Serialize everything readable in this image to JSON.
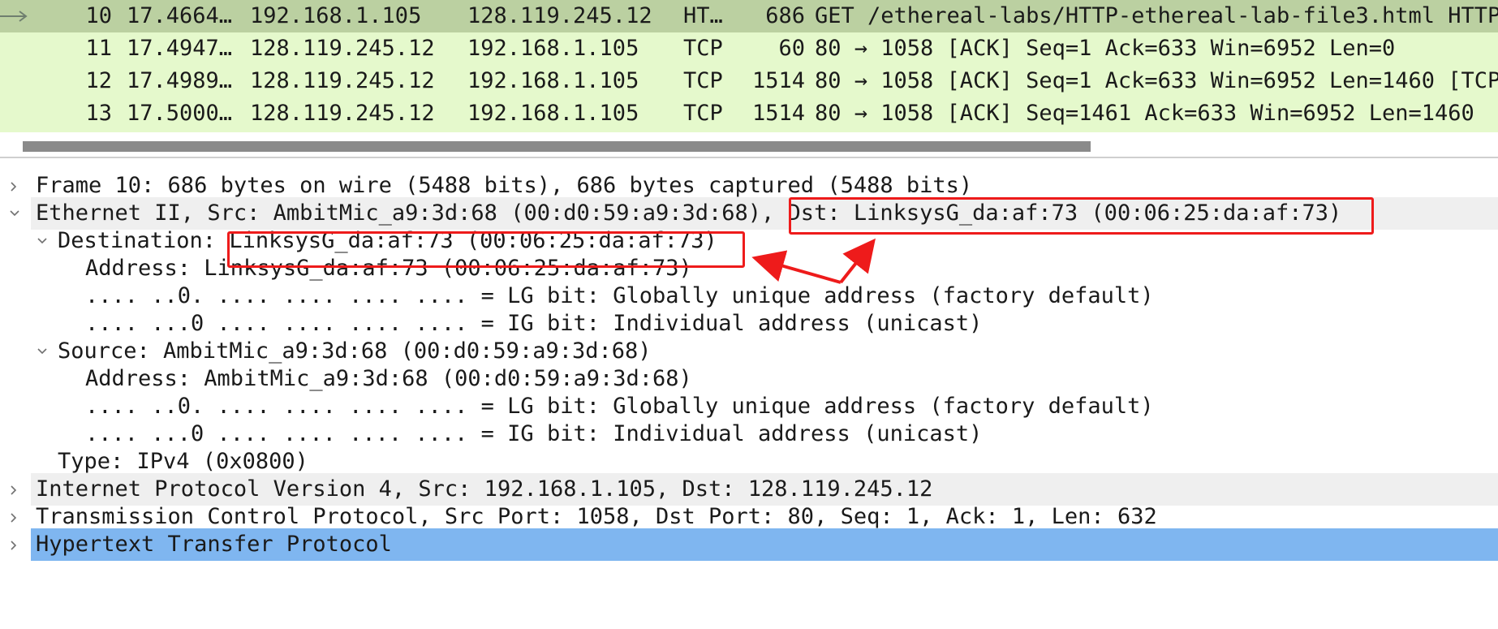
{
  "packet_list": {
    "rows": [
      {
        "no": "10",
        "time": "17.4664…",
        "src": "192.168.1.105",
        "dst": "128.119.245.12",
        "proto": "HT…",
        "len": "686",
        "info": "GET /ethereal-labs/HTTP-ethereal-lab-file3.html HTTP/1.1",
        "selected": true
      },
      {
        "no": "11",
        "time": "17.4947…",
        "src": "128.119.245.12",
        "dst": "192.168.1.105",
        "proto": "TCP",
        "len": "60",
        "info": "80 → 1058 [ACK] Seq=1 Ack=633 Win=6952 Len=0",
        "selected": false
      },
      {
        "no": "12",
        "time": "17.4989…",
        "src": "128.119.245.12",
        "dst": "192.168.1.105",
        "proto": "TCP",
        "len": "1514",
        "info": "80 → 1058 [ACK] Seq=1 Ack=633 Win=6952 Len=1460 [TCP",
        "selected": false
      },
      {
        "no": "13",
        "time": "17.5000…",
        "src": "128.119.245.12",
        "dst": "192.168.1.105",
        "proto": "TCP",
        "len": "1514",
        "info": "80 → 1058 [ACK] Seq=1461 Ack=633 Win=6952 Len=1460",
        "selected": false
      }
    ]
  },
  "detail_tree": {
    "rows": [
      {
        "text": "Frame 10: 686 bytes on wire (5488 bits), 686 bytes captured (5488 bits)",
        "level": 0,
        "toggle": "collapsed",
        "shade": "none"
      },
      {
        "text": "Ethernet II, Src: AmbitMic_a9:3d:68 (00:d0:59:a9:3d:68), Dst: LinksysG_da:af:73 (00:06:25:da:af:73)",
        "level": 0,
        "toggle": "expanded",
        "shade": "shaded"
      },
      {
        "text": "Destination: LinksysG_da:af:73 (00:06:25:da:af:73)",
        "level": 1,
        "toggle": "expanded",
        "shade": "none"
      },
      {
        "text": "Address: LinksysG_da:af:73 (00:06:25:da:af:73)",
        "level": 2,
        "toggle": "none",
        "shade": "none"
      },
      {
        "text": ".... ..0. .... .... .... .... = LG bit: Globally unique address (factory default)",
        "level": 2,
        "toggle": "none",
        "shade": "none"
      },
      {
        "text": ".... ...0 .... .... .... .... = IG bit: Individual address (unicast)",
        "level": 2,
        "toggle": "none",
        "shade": "none"
      },
      {
        "text": "Source: AmbitMic_a9:3d:68 (00:d0:59:a9:3d:68)",
        "level": 1,
        "toggle": "expanded",
        "shade": "none"
      },
      {
        "text": "Address: AmbitMic_a9:3d:68 (00:d0:59:a9:3d:68)",
        "level": 2,
        "toggle": "none",
        "shade": "none"
      },
      {
        "text": ".... ..0. .... .... .... .... = LG bit: Globally unique address (factory default)",
        "level": 2,
        "toggle": "none",
        "shade": "none"
      },
      {
        "text": ".... ...0 .... .... .... .... = IG bit: Individual address (unicast)",
        "level": 2,
        "toggle": "none",
        "shade": "none"
      },
      {
        "text": "Type: IPv4 (0x0800)",
        "level": 1,
        "toggle": "none",
        "shade": "none"
      },
      {
        "text": "Internet Protocol Version 4, Src: 192.168.1.105, Dst: 128.119.245.12",
        "level": 0,
        "toggle": "collapsed",
        "shade": "shaded"
      },
      {
        "text": "Transmission Control Protocol, Src Port: 1058, Dst Port: 80, Seq: 1, Ack: 1, Len: 632",
        "level": 0,
        "toggle": "collapsed",
        "shade": "none"
      },
      {
        "text": "Hypertext Transfer Protocol",
        "level": 0,
        "toggle": "collapsed",
        "shade": "blue"
      }
    ]
  },
  "icons": {
    "related_packet": "arrow-right-icon",
    "collapsed": "chevron-right-icon",
    "expanded": "chevron-down-icon"
  },
  "colors": {
    "packet_bg": "#e5f9cc",
    "packet_selected": "#bbd0a1",
    "selected_tree_row": "#7fb6f0",
    "annotation": "#ee1b1b"
  }
}
